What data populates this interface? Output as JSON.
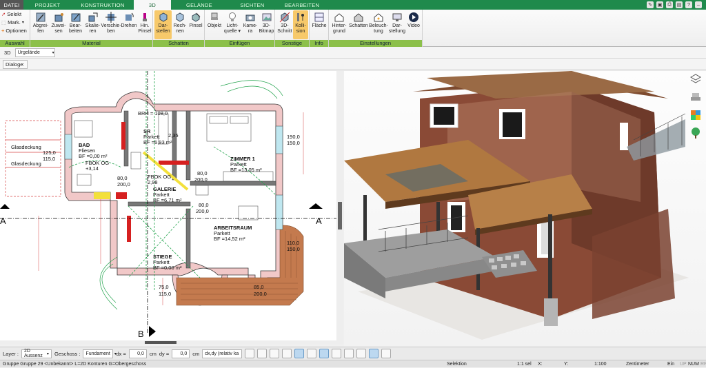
{
  "tabs": [
    "DATEI",
    "PROJEKT",
    "KONSTRUKTION",
    "3D",
    "GELÄNDE",
    "SICHTEN",
    "BEARBEITEN"
  ],
  "ribbon": {
    "side": {
      "selekt": "Selekt",
      "mark": "Mark.",
      "optionen": "Optionen",
      "group": "Auswahl"
    },
    "material": {
      "group": "Material",
      "buttons": [
        "Abgrei-\nfen",
        "Zuwei-\nsen",
        "Bear-\nbeiten",
        "Skalie-\nren",
        "Verschie-\nben",
        "Drehen",
        "Hin.\nPinsel"
      ]
    },
    "schatten": {
      "group": "Schatten",
      "buttons": [
        "Dar-\nstellen",
        "Rech-\nnen",
        "Pinsel"
      ]
    },
    "einfuegen": {
      "group": "Einfügen",
      "buttons": [
        "Objekt",
        "Licht-\nquelle ▾",
        "Kame-\nra",
        "3D-\nBitmap"
      ]
    },
    "sonstige": {
      "group": "Sonstige",
      "buttons": [
        "3D-\nSchnitt",
        "Kolli-\nsion"
      ]
    },
    "info": {
      "group": "Info",
      "buttons": [
        "Fläche"
      ]
    },
    "einstellungen": {
      "group": "Einstellungen",
      "buttons": [
        "Hinter-\ngrund",
        "Schatten",
        "Beleuch-\ntung",
        "Dar-\nstellung",
        "Video"
      ]
    }
  },
  "viewbar": {
    "mode": "3D",
    "selection": "Urgelände"
  },
  "dialoge_label": "Dialoge:",
  "plan": {
    "rooms": [
      {
        "name": "BAD",
        "material": "Fliesen",
        "area": "BF =0,00 m²"
      },
      {
        "name": "SR",
        "material": "Parkett",
        "area": "BF =6,93 m²"
      },
      {
        "name": "ZIMMER 1",
        "material": "Parkett",
        "area": "BF =13,05 m²"
      },
      {
        "name": "GALERIE",
        "material": "Parkett",
        "area": "BF =6,71 m²"
      },
      {
        "name": "ARBEITSRAUM",
        "material": "Parkett",
        "area": "BF =14,52 m²"
      },
      {
        "name": "STIEGE",
        "material": "Parkett",
        "area": "BF =0,00 m²"
      }
    ],
    "labels": {
      "glas1": "Glasdeckung",
      "glas2": "Glasdeckung",
      "d1a": "125,0",
      "d1b": "115,0",
      "d2a": "80,0",
      "d2b": "200,0",
      "d3a": "80,0",
      "d3b": "200,0",
      "d4a": "80,0",
      "d4b": "200,0",
      "d5a": "190,0",
      "d5b": "150,0",
      "d6a": "110,0",
      "d6b": "150,0",
      "fbok1": "FBOK OG",
      "fbok1v": "+3,14",
      "fbok2": "FBOK OG",
      "fbok2v": "2,98",
      "brh": "BRH = 108,0",
      "v235": "2,35",
      "sectA": "A",
      "sectB": "B",
      "d750": "75,0",
      "d1150": "115,0",
      "d850": "85,0",
      "d2000": "200,0"
    }
  },
  "bottombar": {
    "layer_label": "Layer :",
    "layer_value": "2D Aussenz",
    "geschoss_label": "Geschoss :",
    "geschoss_value": "Fundament",
    "dx_label": "dx =",
    "dx_value": "0,0",
    "dx_unit": "cm",
    "dy_label": "dy =",
    "dy_value": "0,0",
    "dy_unit": "cm",
    "coord_mode": "dx,dy (relativ ka"
  },
  "status": {
    "group": "Gruppe Gruppe 29 <Unbekannt> L=2D Konturen G=Obergeschoss",
    "mode": "Selektion",
    "sel": "1:1 sel",
    "x": "X:",
    "y": "Y:",
    "scale": "1:100",
    "unit": "Zentimeter",
    "ein": "Ein",
    "up": "UP",
    "num": "NUM",
    "rf": "RF"
  },
  "colors": {
    "tabbar": "#1f8a4c",
    "group_label": "#8cc04a",
    "active_button": "#f7c96a",
    "wall": "#c0392b",
    "dim": "#d64545"
  }
}
